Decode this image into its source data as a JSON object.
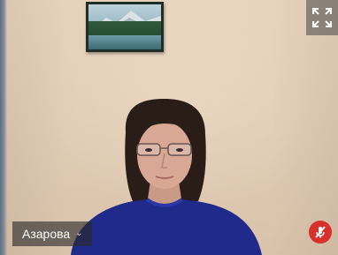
{
  "participant": {
    "name": "Азарова",
    "name_menu_icon": "chevron-down-icon"
  },
  "controls": {
    "fullscreen_icon": "fullscreen-icon",
    "mic_status_icon": "mic-off-icon",
    "mic_status_color": "#d6322b"
  },
  "scene": {
    "wall_color": "#e2cdb6",
    "sweater_color": "#1f2a8a",
    "hair_color": "#2a1c17"
  }
}
